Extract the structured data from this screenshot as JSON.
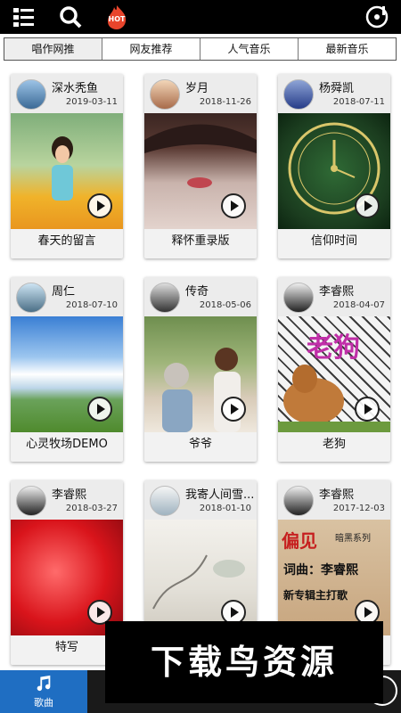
{
  "header": {
    "icons": [
      "menu-icon",
      "search-icon",
      "hot-icon",
      "vinyl-icon"
    ],
    "hot_badge": "HOT"
  },
  "tabs": [
    {
      "label": "唱作网推",
      "active": true
    },
    {
      "label": "网友推荐",
      "active": false
    },
    {
      "label": "人气音乐",
      "active": false
    },
    {
      "label": "最新音乐",
      "active": false
    }
  ],
  "cards": [
    {
      "author": "深水秃鱼",
      "date": "2019-03-11",
      "title": "春天的留言"
    },
    {
      "author": "岁月",
      "date": "2018-11-26",
      "title": "释怀重录版"
    },
    {
      "author": "杨舜凯",
      "date": "2018-07-11",
      "title": "信仰时间"
    },
    {
      "author": "周仁",
      "date": "2018-07-10",
      "title": "心灵牧场DEMO"
    },
    {
      "author": "传奇",
      "date": "2018-05-06",
      "title": "爷爷"
    },
    {
      "author": "李睿熙",
      "date": "2018-04-07",
      "title": "老狗"
    },
    {
      "author": "李睿熙",
      "date": "2018-03-27",
      "title": "特写"
    },
    {
      "author": "我寄人间雪...",
      "date": "2018-01-10",
      "title": ""
    },
    {
      "author": "李睿熙",
      "date": "2017-12-03",
      "title": ""
    }
  ],
  "cover_text": {
    "card6": "老狗",
    "card9_a": "偏见",
    "card9_b": "暗黑系列",
    "card9_c": "词曲：李睿熙",
    "card9_d": "新专辑主打歌"
  },
  "bottom_nav": {
    "active_label": "歌曲"
  },
  "watermark": "下载鸟资源",
  "colors": {
    "accent": "#1f6ec2",
    "topbar": "#000000"
  }
}
